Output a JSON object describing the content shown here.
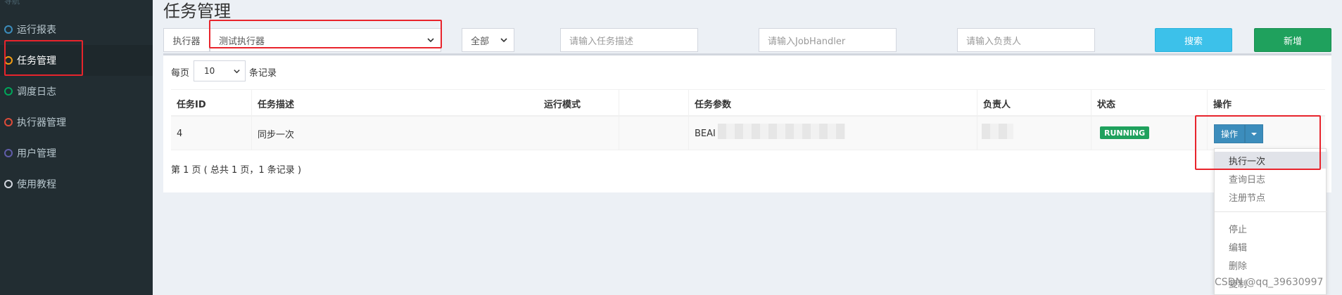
{
  "sidebar": {
    "header": "导航",
    "items": [
      {
        "label": "运行报表",
        "color": "#3c8dbc"
      },
      {
        "label": "任务管理",
        "color": "#f39c12"
      },
      {
        "label": "调度日志",
        "color": "#00a65a"
      },
      {
        "label": "执行器管理",
        "color": "#dd4b39"
      },
      {
        "label": "用户管理",
        "color": "#605ca8"
      },
      {
        "label": "使用教程",
        "color": "#d2d6de"
      }
    ]
  },
  "page": {
    "title": "任务管理"
  },
  "filters": {
    "executor_addon": "执行器",
    "executor_value": "测试执行器",
    "status_value": "全部",
    "desc_placeholder": "请输入任务描述",
    "handler_placeholder": "请输入JobHandler",
    "author_placeholder": "请输入负责人",
    "search_label": "搜索",
    "add_label": "新增"
  },
  "pagesize": {
    "prefix": "每页",
    "value": "10",
    "suffix": "条记录"
  },
  "table": {
    "headers": [
      "任务ID",
      "任务描述",
      "运行模式",
      "任务参数",
      "负责人",
      "状态",
      "操作"
    ],
    "rows": [
      {
        "id": "4",
        "desc": "同步一次",
        "mode": "",
        "param": "BEAI",
        "author": "",
        "status": "RUNNING"
      }
    ]
  },
  "operate": {
    "label": "操作"
  },
  "page_info": "第 1 页 ( 总共 1 页，1 条记录 )",
  "dropdown": {
    "items": [
      "执行一次",
      "查询日志",
      "注册节点",
      "停止",
      "编辑",
      "删除",
      "复制"
    ]
  },
  "watermark": "CSDN @qq_39630997",
  "colors": {
    "accent": "#3c8dbc",
    "success": "#1fa15d",
    "info": "#3cc1ea",
    "highlight": "#e8242c"
  }
}
